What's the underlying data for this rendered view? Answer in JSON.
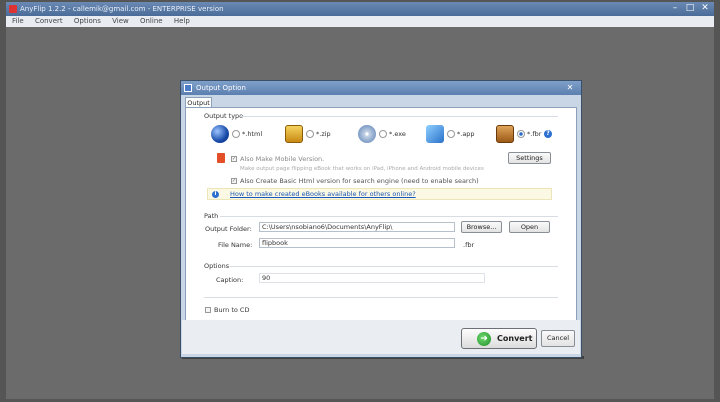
{
  "app": {
    "title": "AnyFlip 1.2.2 - callemik@gmail.com - ENTERPRISE version",
    "menu": [
      "File",
      "Convert",
      "Options",
      "View",
      "Online",
      "Help"
    ]
  },
  "dialog": {
    "title": "Output Option",
    "tab": "Output",
    "output_type": {
      "label": "Output type",
      "options": [
        {
          "label": "*.html",
          "icon": "globe-icon",
          "selected": false
        },
        {
          "label": "*.zip",
          "icon": "zip-archive-icon",
          "selected": false
        },
        {
          "label": "*.exe",
          "icon": "cd-exe-icon",
          "selected": false
        },
        {
          "label": "*.app",
          "icon": "mac-app-icon",
          "selected": false
        },
        {
          "label": "*.fbr",
          "icon": "book-icon",
          "selected": true
        }
      ],
      "mobile_label": "Also Make Mobile Version.",
      "mobile_hint": "Make output page flipping eBook that works on iPad, iPhone and Android mobile devices",
      "basic_html_label": "Also Create Basic Html version for search engine (need to enable search)",
      "settings_label": "Settings",
      "help_label": "?",
      "info_link": "How to make created eBooks available for others online?"
    },
    "path": {
      "label": "Path",
      "output_folder_label": "Output Folder:",
      "output_folder_value": "C:\\Users\\nsobiano6\\Documents\\AnyFlip\\",
      "browse_label": "Browse...",
      "open_label": "Open",
      "file_name_label": "File Name:",
      "file_name_value": "flipbook",
      "extension": ".fbr"
    },
    "options": {
      "label": "Options",
      "caption_label": "Caption:",
      "caption_value": "90"
    },
    "burn_to_cd_label": "Burn to CD",
    "convert_label": "Convert",
    "cancel_label": "Cancel"
  }
}
